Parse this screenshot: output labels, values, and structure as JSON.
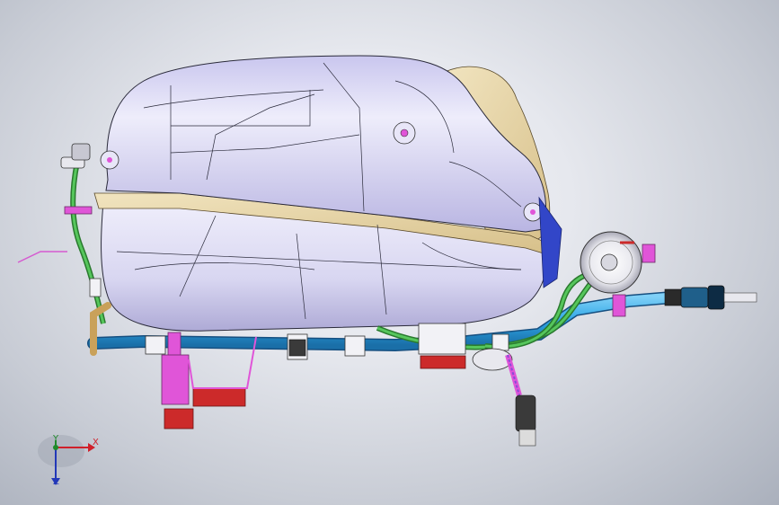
{
  "viewport": {
    "background_top": "#f4f5f8",
    "background_edge": "#aab0bc"
  },
  "model": {
    "tank_color": "#d8d6f2",
    "shield_color": "#e8d9b0",
    "main_pipe_color": "#2fa6e6",
    "hose_color": "#3fb545",
    "clip_color": "#e055d8",
    "bracket_color": "#cc2a2a",
    "filler_connector_color": "#b8b8b8"
  },
  "triad": {
    "x_label": "X",
    "y_label": "Y",
    "z_label": "Z",
    "x_color": "#d0202a",
    "y_color": "#1f8a2a",
    "z_color": "#2238b8"
  }
}
